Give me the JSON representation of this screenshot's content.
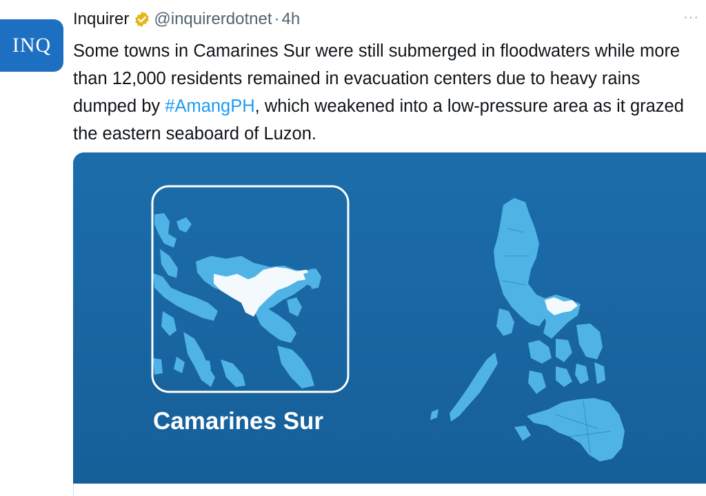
{
  "avatar": {
    "text": "INQ"
  },
  "header": {
    "name": "Inquirer",
    "handle": "@inquirerdotnet",
    "separator": "·",
    "time": "4h",
    "more": "···"
  },
  "tweet": {
    "text_before": "Some towns in Camarines Sur were still submerged in floodwaters while more than 12,000 residents remained in evacuation centers due to heavy rains dumped by ",
    "hashtag": "#AmangPH",
    "text_after": ", which weakened into a low-pressure area as it grazed the eastern seaboard of Luzon."
  },
  "media": {
    "map_title": "Camarines Sur"
  },
  "colors": {
    "accent": "#1d9bf0",
    "sea": "#1a6aa7",
    "land": "#4fb3e6",
    "highlight": "#f4f9fd",
    "verified_badge": "#e2b719"
  },
  "icons": {
    "verified": "verified-badge-icon",
    "more": "more-options-icon"
  }
}
